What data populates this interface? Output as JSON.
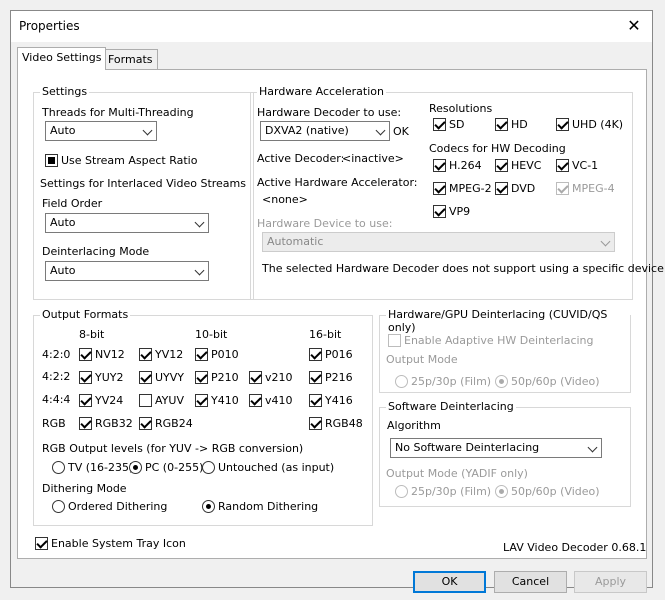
{
  "window": {
    "title": "Properties"
  },
  "tabs": {
    "video_settings": "Video Settings",
    "formats": "Formats"
  },
  "settings": {
    "group": "Settings",
    "threads_label": "Threads for Multi-Threading",
    "threads_value": "Auto",
    "stream_aspect": "Use Stream Aspect Ratio",
    "interlaced_label": "Settings for Interlaced Video Streams",
    "field_order_label": "Field Order",
    "field_order_value": "Auto",
    "deint_mode_label": "Deinterlacing Mode",
    "deint_mode_value": "Auto"
  },
  "hwaccel": {
    "group": "Hardware Acceleration",
    "decoder_label": "Hardware Decoder to use:",
    "decoder_value": "DXVA2 (native)",
    "decoder_status": "OK",
    "active_decoder_label": "Active Decoder:",
    "active_decoder_value": "<inactive>",
    "active_accel_label": "Active Hardware Accelerator:",
    "active_accel_value": "<none>",
    "device_label": "Hardware Device to use:",
    "device_value": "Automatic",
    "device_note": "The selected Hardware Decoder does not support using a specific device.",
    "resolutions_label": "Resolutions",
    "res_sd": "SD",
    "res_hd": "HD",
    "res_uhd": "UHD (4K)",
    "codecs_label": "Codecs for HW Decoding",
    "c_h264": "H.264",
    "c_hevc": "HEVC",
    "c_vc1": "VC-1",
    "c_mpeg2": "MPEG-2",
    "c_dvd": "DVD",
    "c_mpeg4": "MPEG-4",
    "c_vp9": "VP9"
  },
  "output": {
    "group": "Output Formats",
    "h_8bit": "8-bit",
    "h_10bit": "10-bit",
    "h_16bit": "16-bit",
    "r_420": "4:2:0",
    "r_422": "4:2:2",
    "r_444": "4:4:4",
    "r_rgb": "RGB",
    "nv12": "NV12",
    "yv12": "YV12",
    "p010": "P010",
    "p016": "P016",
    "yuy2": "YUY2",
    "uyvy": "UYVY",
    "p210": "P210",
    "v210": "v210",
    "p216": "P216",
    "yv24": "YV24",
    "ayuv": "AYUV",
    "y410": "Y410",
    "v410": "v410",
    "y416": "Y416",
    "rgb32": "RGB32",
    "rgb24": "RGB24",
    "rgb48": "RGB48",
    "levels_label": "RGB Output levels (for YUV -> RGB conversion)",
    "lv_tv": "TV (16-235)",
    "lv_pc": "PC (0-255)",
    "lv_untouched": "Untouched (as input)",
    "dither_label": "Dithering Mode",
    "dither_ordered": "Ordered Dithering",
    "dither_random": "Random Dithering"
  },
  "hwdeint": {
    "group": "Hardware/GPU Deinterlacing (CUVID/QS only)",
    "adaptive": "Enable Adaptive HW Deinterlacing",
    "output_mode": "Output Mode",
    "film": "25p/30p (Film)",
    "video": "50p/60p (Video)"
  },
  "swdeint": {
    "group": "Software Deinterlacing",
    "algo_label": "Algorithm",
    "algo_value": "No Software Deinterlacing",
    "output_mode": "Output Mode (YADIF only)",
    "film": "25p/30p (Film)",
    "video": "50p/60p (Video)"
  },
  "footer": {
    "tray": "Enable System Tray Icon",
    "version": "LAV Video Decoder 0.68.1"
  },
  "buttons": {
    "ok": "OK",
    "cancel": "Cancel",
    "apply": "Apply"
  }
}
